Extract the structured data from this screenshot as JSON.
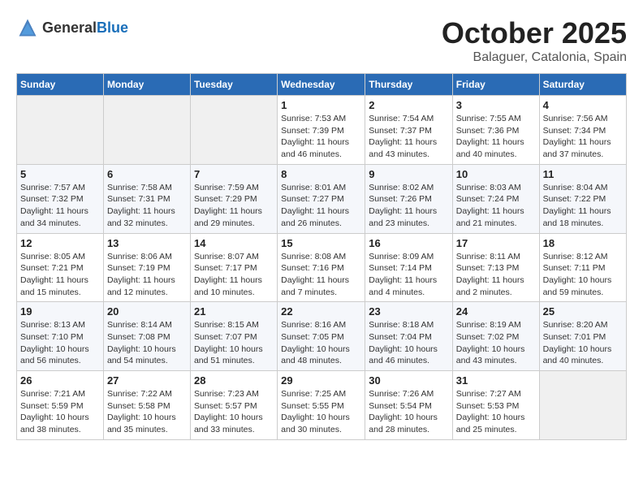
{
  "header": {
    "logo_general": "General",
    "logo_blue": "Blue",
    "month_title": "October 2025",
    "subtitle": "Balaguer, Catalonia, Spain"
  },
  "days_of_week": [
    "Sunday",
    "Monday",
    "Tuesday",
    "Wednesday",
    "Thursday",
    "Friday",
    "Saturday"
  ],
  "weeks": [
    [
      {
        "day": "",
        "info": ""
      },
      {
        "day": "",
        "info": ""
      },
      {
        "day": "",
        "info": ""
      },
      {
        "day": "1",
        "info": "Sunrise: 7:53 AM\nSunset: 7:39 PM\nDaylight: 11 hours and 46 minutes."
      },
      {
        "day": "2",
        "info": "Sunrise: 7:54 AM\nSunset: 7:37 PM\nDaylight: 11 hours and 43 minutes."
      },
      {
        "day": "3",
        "info": "Sunrise: 7:55 AM\nSunset: 7:36 PM\nDaylight: 11 hours and 40 minutes."
      },
      {
        "day": "4",
        "info": "Sunrise: 7:56 AM\nSunset: 7:34 PM\nDaylight: 11 hours and 37 minutes."
      }
    ],
    [
      {
        "day": "5",
        "info": "Sunrise: 7:57 AM\nSunset: 7:32 PM\nDaylight: 11 hours and 34 minutes."
      },
      {
        "day": "6",
        "info": "Sunrise: 7:58 AM\nSunset: 7:31 PM\nDaylight: 11 hours and 32 minutes."
      },
      {
        "day": "7",
        "info": "Sunrise: 7:59 AM\nSunset: 7:29 PM\nDaylight: 11 hours and 29 minutes."
      },
      {
        "day": "8",
        "info": "Sunrise: 8:01 AM\nSunset: 7:27 PM\nDaylight: 11 hours and 26 minutes."
      },
      {
        "day": "9",
        "info": "Sunrise: 8:02 AM\nSunset: 7:26 PM\nDaylight: 11 hours and 23 minutes."
      },
      {
        "day": "10",
        "info": "Sunrise: 8:03 AM\nSunset: 7:24 PM\nDaylight: 11 hours and 21 minutes."
      },
      {
        "day": "11",
        "info": "Sunrise: 8:04 AM\nSunset: 7:22 PM\nDaylight: 11 hours and 18 minutes."
      }
    ],
    [
      {
        "day": "12",
        "info": "Sunrise: 8:05 AM\nSunset: 7:21 PM\nDaylight: 11 hours and 15 minutes."
      },
      {
        "day": "13",
        "info": "Sunrise: 8:06 AM\nSunset: 7:19 PM\nDaylight: 11 hours and 12 minutes."
      },
      {
        "day": "14",
        "info": "Sunrise: 8:07 AM\nSunset: 7:17 PM\nDaylight: 11 hours and 10 minutes."
      },
      {
        "day": "15",
        "info": "Sunrise: 8:08 AM\nSunset: 7:16 PM\nDaylight: 11 hours and 7 minutes."
      },
      {
        "day": "16",
        "info": "Sunrise: 8:09 AM\nSunset: 7:14 PM\nDaylight: 11 hours and 4 minutes."
      },
      {
        "day": "17",
        "info": "Sunrise: 8:11 AM\nSunset: 7:13 PM\nDaylight: 11 hours and 2 minutes."
      },
      {
        "day": "18",
        "info": "Sunrise: 8:12 AM\nSunset: 7:11 PM\nDaylight: 10 hours and 59 minutes."
      }
    ],
    [
      {
        "day": "19",
        "info": "Sunrise: 8:13 AM\nSunset: 7:10 PM\nDaylight: 10 hours and 56 minutes."
      },
      {
        "day": "20",
        "info": "Sunrise: 8:14 AM\nSunset: 7:08 PM\nDaylight: 10 hours and 54 minutes."
      },
      {
        "day": "21",
        "info": "Sunrise: 8:15 AM\nSunset: 7:07 PM\nDaylight: 10 hours and 51 minutes."
      },
      {
        "day": "22",
        "info": "Sunrise: 8:16 AM\nSunset: 7:05 PM\nDaylight: 10 hours and 48 minutes."
      },
      {
        "day": "23",
        "info": "Sunrise: 8:18 AM\nSunset: 7:04 PM\nDaylight: 10 hours and 46 minutes."
      },
      {
        "day": "24",
        "info": "Sunrise: 8:19 AM\nSunset: 7:02 PM\nDaylight: 10 hours and 43 minutes."
      },
      {
        "day": "25",
        "info": "Sunrise: 8:20 AM\nSunset: 7:01 PM\nDaylight: 10 hours and 40 minutes."
      }
    ],
    [
      {
        "day": "26",
        "info": "Sunrise: 7:21 AM\nSunset: 5:59 PM\nDaylight: 10 hours and 38 minutes."
      },
      {
        "day": "27",
        "info": "Sunrise: 7:22 AM\nSunset: 5:58 PM\nDaylight: 10 hours and 35 minutes."
      },
      {
        "day": "28",
        "info": "Sunrise: 7:23 AM\nSunset: 5:57 PM\nDaylight: 10 hours and 33 minutes."
      },
      {
        "day": "29",
        "info": "Sunrise: 7:25 AM\nSunset: 5:55 PM\nDaylight: 10 hours and 30 minutes."
      },
      {
        "day": "30",
        "info": "Sunrise: 7:26 AM\nSunset: 5:54 PM\nDaylight: 10 hours and 28 minutes."
      },
      {
        "day": "31",
        "info": "Sunrise: 7:27 AM\nSunset: 5:53 PM\nDaylight: 10 hours and 25 minutes."
      },
      {
        "day": "",
        "info": ""
      }
    ]
  ]
}
